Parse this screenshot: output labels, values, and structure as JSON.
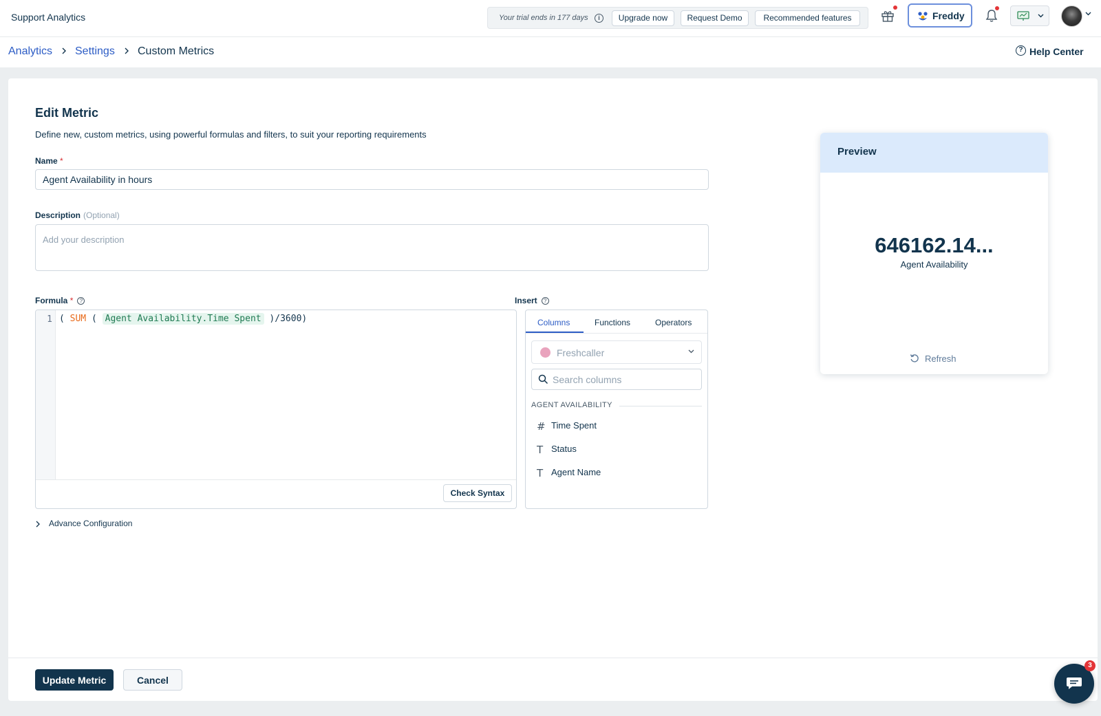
{
  "app": {
    "title": "Support Analytics"
  },
  "topbar": {
    "trial_text": "Your trial ends in 177 days",
    "buttons": [
      "Upgrade now",
      "Request Demo",
      "Recommended features"
    ],
    "freddy_label": "Freddy",
    "icons": [
      "gift-icon",
      "bell-icon",
      "monitor-icon",
      "avatar"
    ]
  },
  "breadcrumb": {
    "items": [
      "Analytics",
      "Settings",
      "Custom Metrics"
    ],
    "help": "Help Center"
  },
  "form": {
    "title": "Edit Metric",
    "subtitle": "Define new, custom metrics, using powerful formulas and filters, to suit your reporting requirements",
    "name_label": "Name",
    "required_mark": "*",
    "name_value": "Agent Availability in hours",
    "description_label": "Description",
    "description_optional": "(Optional)",
    "description_placeholder": "Add your description",
    "formula_label": "Formula",
    "formula": {
      "line_number": "1",
      "open": "( ",
      "fn": "SUM",
      "paren": " ( ",
      "column": "Agent Availability.Time Spent",
      "close": " )/3600)"
    },
    "check_syntax": "Check Syntax",
    "advance_config": "Advance Configuration"
  },
  "insert": {
    "label": "Insert",
    "tabs": [
      "Columns",
      "Functions",
      "Operators"
    ],
    "active_tab": "Columns",
    "source": "Freshcaller",
    "search_placeholder": "Search columns",
    "group": "AGENT AVAILABILITY",
    "columns": [
      {
        "glyph": "#",
        "name": "Time Spent"
      },
      {
        "glyph": "T",
        "name": "Status"
      },
      {
        "glyph": "T",
        "name": "Agent Name"
      }
    ]
  },
  "preview": {
    "title": "Preview",
    "value": "646162.14...",
    "label": "Agent Availability",
    "refresh": "Refresh"
  },
  "footer": {
    "update": "Update Metric",
    "cancel": "Cancel"
  },
  "chat": {
    "badge": "3"
  },
  "colors": {
    "primary": "#12344d",
    "link": "#2c5cc5",
    "preview_header": "#dbeafc"
  }
}
